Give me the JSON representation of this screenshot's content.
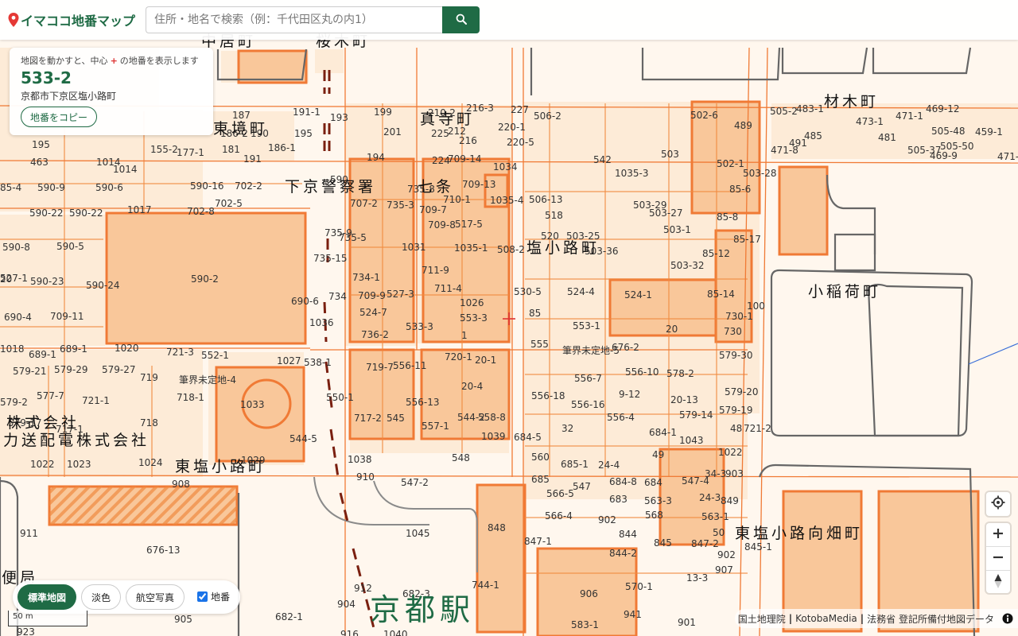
{
  "header": {
    "app_title": "イマココ地番マップ",
    "search_placeholder": "住所・地名で検索（例：千代田区丸の内1）",
    "search_icon": "magnifier-icon",
    "accent_color": "#1f6b45"
  },
  "info_panel": {
    "hint_before": "地図を動かすと、中心",
    "hint_mark": "+",
    "hint_after": "の地番を表示します",
    "parcel_number": "533-2",
    "address": "京都市下京区塩小路町",
    "copy_label": "地番をコピー"
  },
  "basemap": {
    "options": [
      "標準地図",
      "淡色",
      "航空写真"
    ],
    "selected": "標準地図",
    "overlay_label": "地番",
    "overlay_checked": true
  },
  "scale_label": "50 m",
  "controls": {
    "locate": "crosshair-icon",
    "zoom_in": "plus-icon",
    "zoom_out": "minus-icon",
    "compass": "compass-icon"
  },
  "attribution": {
    "items": [
      "国土地理院",
      "KotobaMedia",
      "法務省 登記所備付地図データ"
    ],
    "separator": "|"
  },
  "map": {
    "town_names": [
      "中居町",
      "桜木町",
      "真寺町",
      "材木町",
      "東境町",
      "下京警察署",
      "七条",
      "塩小路町",
      "小稲荷町",
      "東塩小路町",
      "東塩小路向畑町",
      "株式会社",
      "力送配電株式会社",
      "便局"
    ],
    "station_name": "京都駅",
    "parcel_labels": [
      "199",
      "193",
      "216-3",
      "227",
      "210-2",
      "506-2",
      "502-6",
      "489",
      "505-2",
      "483-1",
      "469-12",
      "473-1",
      "471-1",
      "505-48",
      "459-1",
      "191-1",
      "195",
      "201",
      "225",
      "212",
      "220-1",
      "216",
      "220-5",
      "187",
      "186-2",
      "190",
      "195",
      "155-2",
      "177-1",
      "181",
      "186-1",
      "191",
      "194",
      "224",
      "709-14",
      "1034",
      "542",
      "503",
      "502-1",
      "491",
      "485",
      "481",
      "471-8",
      "505-37",
      "505-50",
      "469-9",
      "471-12",
      "463",
      "1014",
      "1014",
      "590",
      "735-8",
      "709-13",
      "1035-3",
      "503-28",
      "85-4",
      "590-9",
      "590-6",
      "590-16",
      "702-2",
      "707-2",
      "735-3",
      "710-1",
      "506-13",
      "503-29",
      "85-6",
      "590-22",
      "590-22",
      "1017",
      "702-8",
      "702-5",
      "709-7",
      "1035-4",
      "518",
      "503-27",
      "85-8",
      "735-9",
      "709-8",
      "517-5",
      "503-1",
      "520",
      "503-25",
      "85-17",
      "590-8",
      "590-5",
      "735-5",
      "1031",
      "1035-1",
      "508-2",
      "503-36",
      "85-12",
      "735-15",
      "503-32",
      "590-2",
      "734-1",
      "711-9",
      "527-1",
      "590-23",
      "590-24",
      "711-4",
      "530-5",
      "524-4",
      "524-1",
      "85-14",
      "100",
      "20",
      "734",
      "709-9",
      "527-3",
      "1026",
      "690-6",
      "690-4",
      "709-11",
      "524-7",
      "85",
      "730-1",
      "1036",
      "553-3",
      "553-1",
      "20",
      "730",
      "736-2",
      "533-3",
      "1",
      "1018",
      "689-1",
      "689-1",
      "1020",
      "721-3",
      "552-1",
      "555",
      "筆界未定地-5",
      "676-2",
      "720-1",
      "1027",
      "538-1",
      "20-1",
      "579-30",
      "579-21",
      "579-29",
      "579-27",
      "719",
      "719-7",
      "556-11",
      "556-7",
      "556-10",
      "578-2",
      "筆界未定地-4",
      "20-4",
      "579-20",
      "577-7",
      "718-1",
      "550-1",
      "556-18",
      "9-12",
      "579-2",
      "721-1",
      "1033",
      "556-13",
      "556-16",
      "20-13",
      "579-19",
      "579-17",
      "718",
      "717-2",
      "545",
      "544-2",
      "558-8",
      "556-4",
      "579-14",
      "717-1",
      "557-1",
      "32",
      "48",
      "721-2",
      "544-5",
      "1039",
      "684-5",
      "684-1",
      "1043",
      "49",
      "1022",
      "1022",
      "1023",
      "1024",
      "1029",
      "1038",
      "548",
      "560",
      "685-1",
      "24-4",
      "34-3",
      "903",
      "908",
      "910",
      "547-2",
      "685",
      "684-8",
      "684",
      "547-4",
      "547",
      "566-5",
      "563-3",
      "683",
      "24-3",
      "849",
      "848",
      "566-4",
      "568",
      "563-1",
      "902",
      "911",
      "1045",
      "844",
      "50",
      "845-1",
      "845",
      "847-2",
      "847-1",
      "844-2",
      "902",
      "676-13",
      "744-1",
      "13-3",
      "907",
      "912",
      "682-3",
      "570-1",
      "906",
      "904",
      "905",
      "682-1",
      "941",
      "583-1",
      "901",
      "923",
      "916",
      "1040"
    ]
  }
}
